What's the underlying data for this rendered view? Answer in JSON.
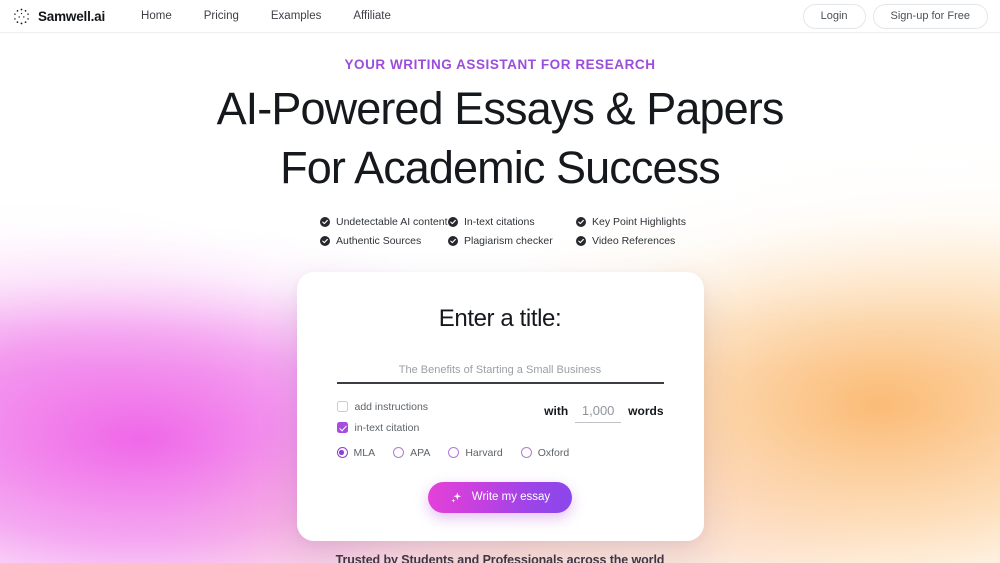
{
  "brand": {
    "name": "Samwell.ai",
    "logo_icon": "dotted-circle-logo"
  },
  "nav": {
    "links": [
      {
        "label": "Home"
      },
      {
        "label": "Pricing"
      },
      {
        "label": "Examples"
      },
      {
        "label": "Affiliate"
      }
    ],
    "login_label": "Login",
    "signup_label": "Sign-up for Free"
  },
  "hero": {
    "eyebrow": "YOUR WRITING ASSISTANT FOR RESEARCH",
    "headline_line1": "AI-Powered Essays & Papers",
    "headline_line2": "For Academic Success",
    "eyebrow_color": "#9b4ddb"
  },
  "features": [
    {
      "label": "Undetectable AI content"
    },
    {
      "label": "In-text citations"
    },
    {
      "label": "Key Point Highlights"
    },
    {
      "label": "Authentic Sources"
    },
    {
      "label": "Plagiarism checker"
    },
    {
      "label": "Video References"
    }
  ],
  "card": {
    "title": "Enter a title:",
    "title_input_value": "",
    "title_input_placeholder": "The Benefits of Starting a Small Business",
    "checkboxes": [
      {
        "label": "add instructions",
        "checked": false
      },
      {
        "label": "in-text citation",
        "checked": true
      }
    ],
    "word_count": {
      "prefix": "with",
      "value": "1,000",
      "suffix": "words"
    },
    "citation_styles": [
      {
        "label": "MLA",
        "selected": true
      },
      {
        "label": "APA",
        "selected": false
      },
      {
        "label": "Harvard",
        "selected": false
      },
      {
        "label": "Oxford",
        "selected": false
      }
    ],
    "cta_label": "Write my essay",
    "cta_icon": "sparkle-icon",
    "accent_color": "#a64ce0"
  },
  "footer": {
    "trusted_text": "Trusted by Students and Professionals across the world"
  }
}
